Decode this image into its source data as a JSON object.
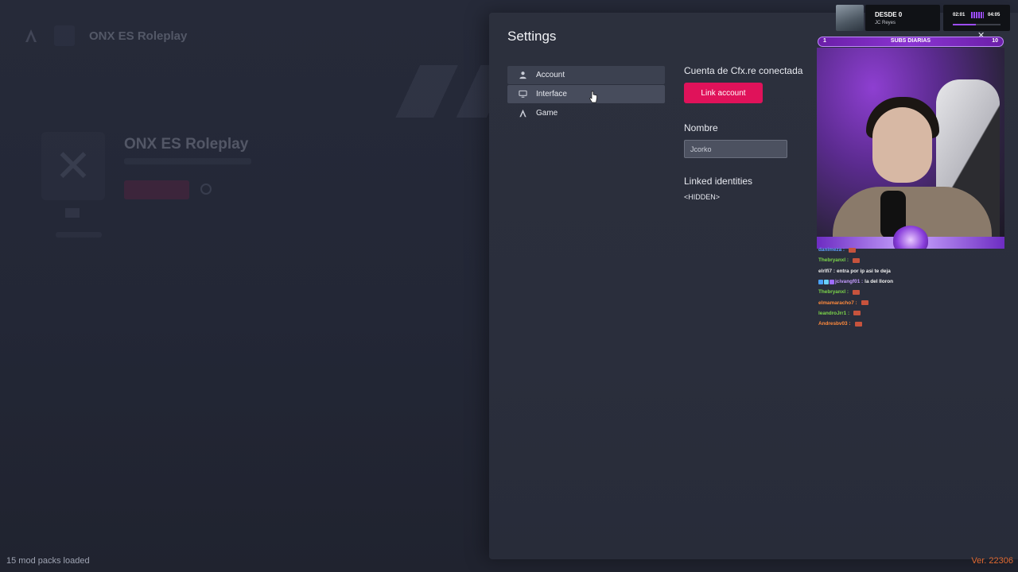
{
  "background": {
    "app_title": "ONX ES Roleplay",
    "server_name": "ONX ES Roleplay"
  },
  "settings": {
    "title": "Settings",
    "nav": [
      {
        "label": "Account",
        "icon": "user-icon"
      },
      {
        "label": "Interface",
        "icon": "monitor-icon"
      },
      {
        "label": "Game",
        "icon": "game-logo-icon"
      }
    ],
    "account": {
      "cfx_label": "Cuenta de Cfx.re conectada",
      "link_button": "Link account",
      "name_label": "Nombre",
      "name_value": "Jcorko",
      "linked_identities_label": "Linked identities",
      "linked_identities_value": "<HIDDEN>"
    }
  },
  "overlay": {
    "now_playing": {
      "title": "DESDE 0",
      "artist": "JC Reyes",
      "elapsed": "02:01",
      "total": "04:05",
      "progress": 0.49
    },
    "subs_goal": {
      "label": "SUBS DIARIAS",
      "min": "1",
      "max": "10"
    },
    "close_symbol": "✕",
    "chat": [
      {
        "user": "danimeza :",
        "message": "",
        "color": "#5da0ff",
        "emote": true
      },
      {
        "user": "Thebryanxl :",
        "message": "",
        "color": "#7cd64a",
        "emote": true
      },
      {
        "user": "elrlfi7 :",
        "message": "entra por ip asi te deja",
        "color": "#e8e8e8",
        "emote": false
      },
      {
        "user": "jcivangf01 :",
        "message": "la del lloron",
        "color": "#c49bff",
        "emote": false
      },
      {
        "user": "Thebryanxl :",
        "message": "",
        "color": "#7cd64a",
        "emote": true
      },
      {
        "user": "elmamaracho7 :",
        "message": "",
        "color": "#ff8a3d",
        "emote": true
      },
      {
        "user": "leandroJrr1 :",
        "message": "",
        "color": "#7cd64a",
        "emote": true
      },
      {
        "user": "Andresbv03 :",
        "message": "",
        "color": "#ff8a3d",
        "emote": true
      }
    ]
  },
  "footer": {
    "mod_status": "15 mod packs loaded",
    "version": "Ver. 22306"
  }
}
